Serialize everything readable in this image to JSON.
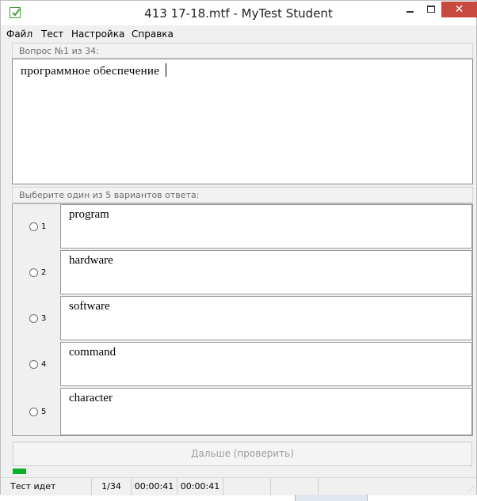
{
  "window": {
    "title": "413 17-18.mtf - MyTest Student",
    "close_label": "✕"
  },
  "menu": [
    "Файл",
    "Тест",
    "Настройка",
    "Справка"
  ],
  "question": {
    "header": "Вопрос №1 из 34:",
    "text": "программное  обеспечение"
  },
  "answers": {
    "header": "Выберите один из 5 вариантов ответа:",
    "options": [
      {
        "num": "1",
        "text": "program"
      },
      {
        "num": "2",
        "text": "hardware"
      },
      {
        "num": "3",
        "text": "software"
      },
      {
        "num": "4",
        "text": "command"
      },
      {
        "num": "5",
        "text": "character"
      }
    ]
  },
  "next_button_label": "Дальше (проверить)",
  "progress": {
    "fraction": 0.029,
    "color": "#06b025"
  },
  "status": {
    "state": "Тест идет",
    "position": "1/34",
    "time_elapsed": "00:00:41",
    "time_total": "00:00:41"
  },
  "colors": {
    "close_button": "#c74a3f",
    "app_icon": "#4a9a3a"
  }
}
